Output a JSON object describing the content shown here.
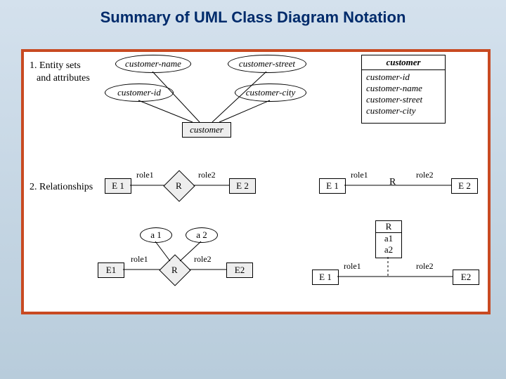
{
  "title": "Summary of UML Class Diagram Notation",
  "section1": {
    "label1": "1. Entity sets",
    "label2": "and attributes",
    "attrs": {
      "cname": "customer-name",
      "cstreet": "customer-street",
      "cid": "customer-id",
      "ccity": "customer-city"
    },
    "entity": "customer",
    "umlclass": {
      "name": "customer",
      "a1": "customer-id",
      "a2": "customer-name",
      "a3": "customer-street",
      "a4": "customer-city"
    }
  },
  "section2": {
    "label": "2. Relationships",
    "e1": "E 1",
    "e2": "E 2",
    "r": "R",
    "role1": "role1",
    "role2": "role2",
    "a1": "a 1",
    "a2": "a 2",
    "e1b": "E1",
    "e2b": "E2",
    "umlr": {
      "r": "R",
      "a1": "a1",
      "a2": "a2"
    }
  }
}
